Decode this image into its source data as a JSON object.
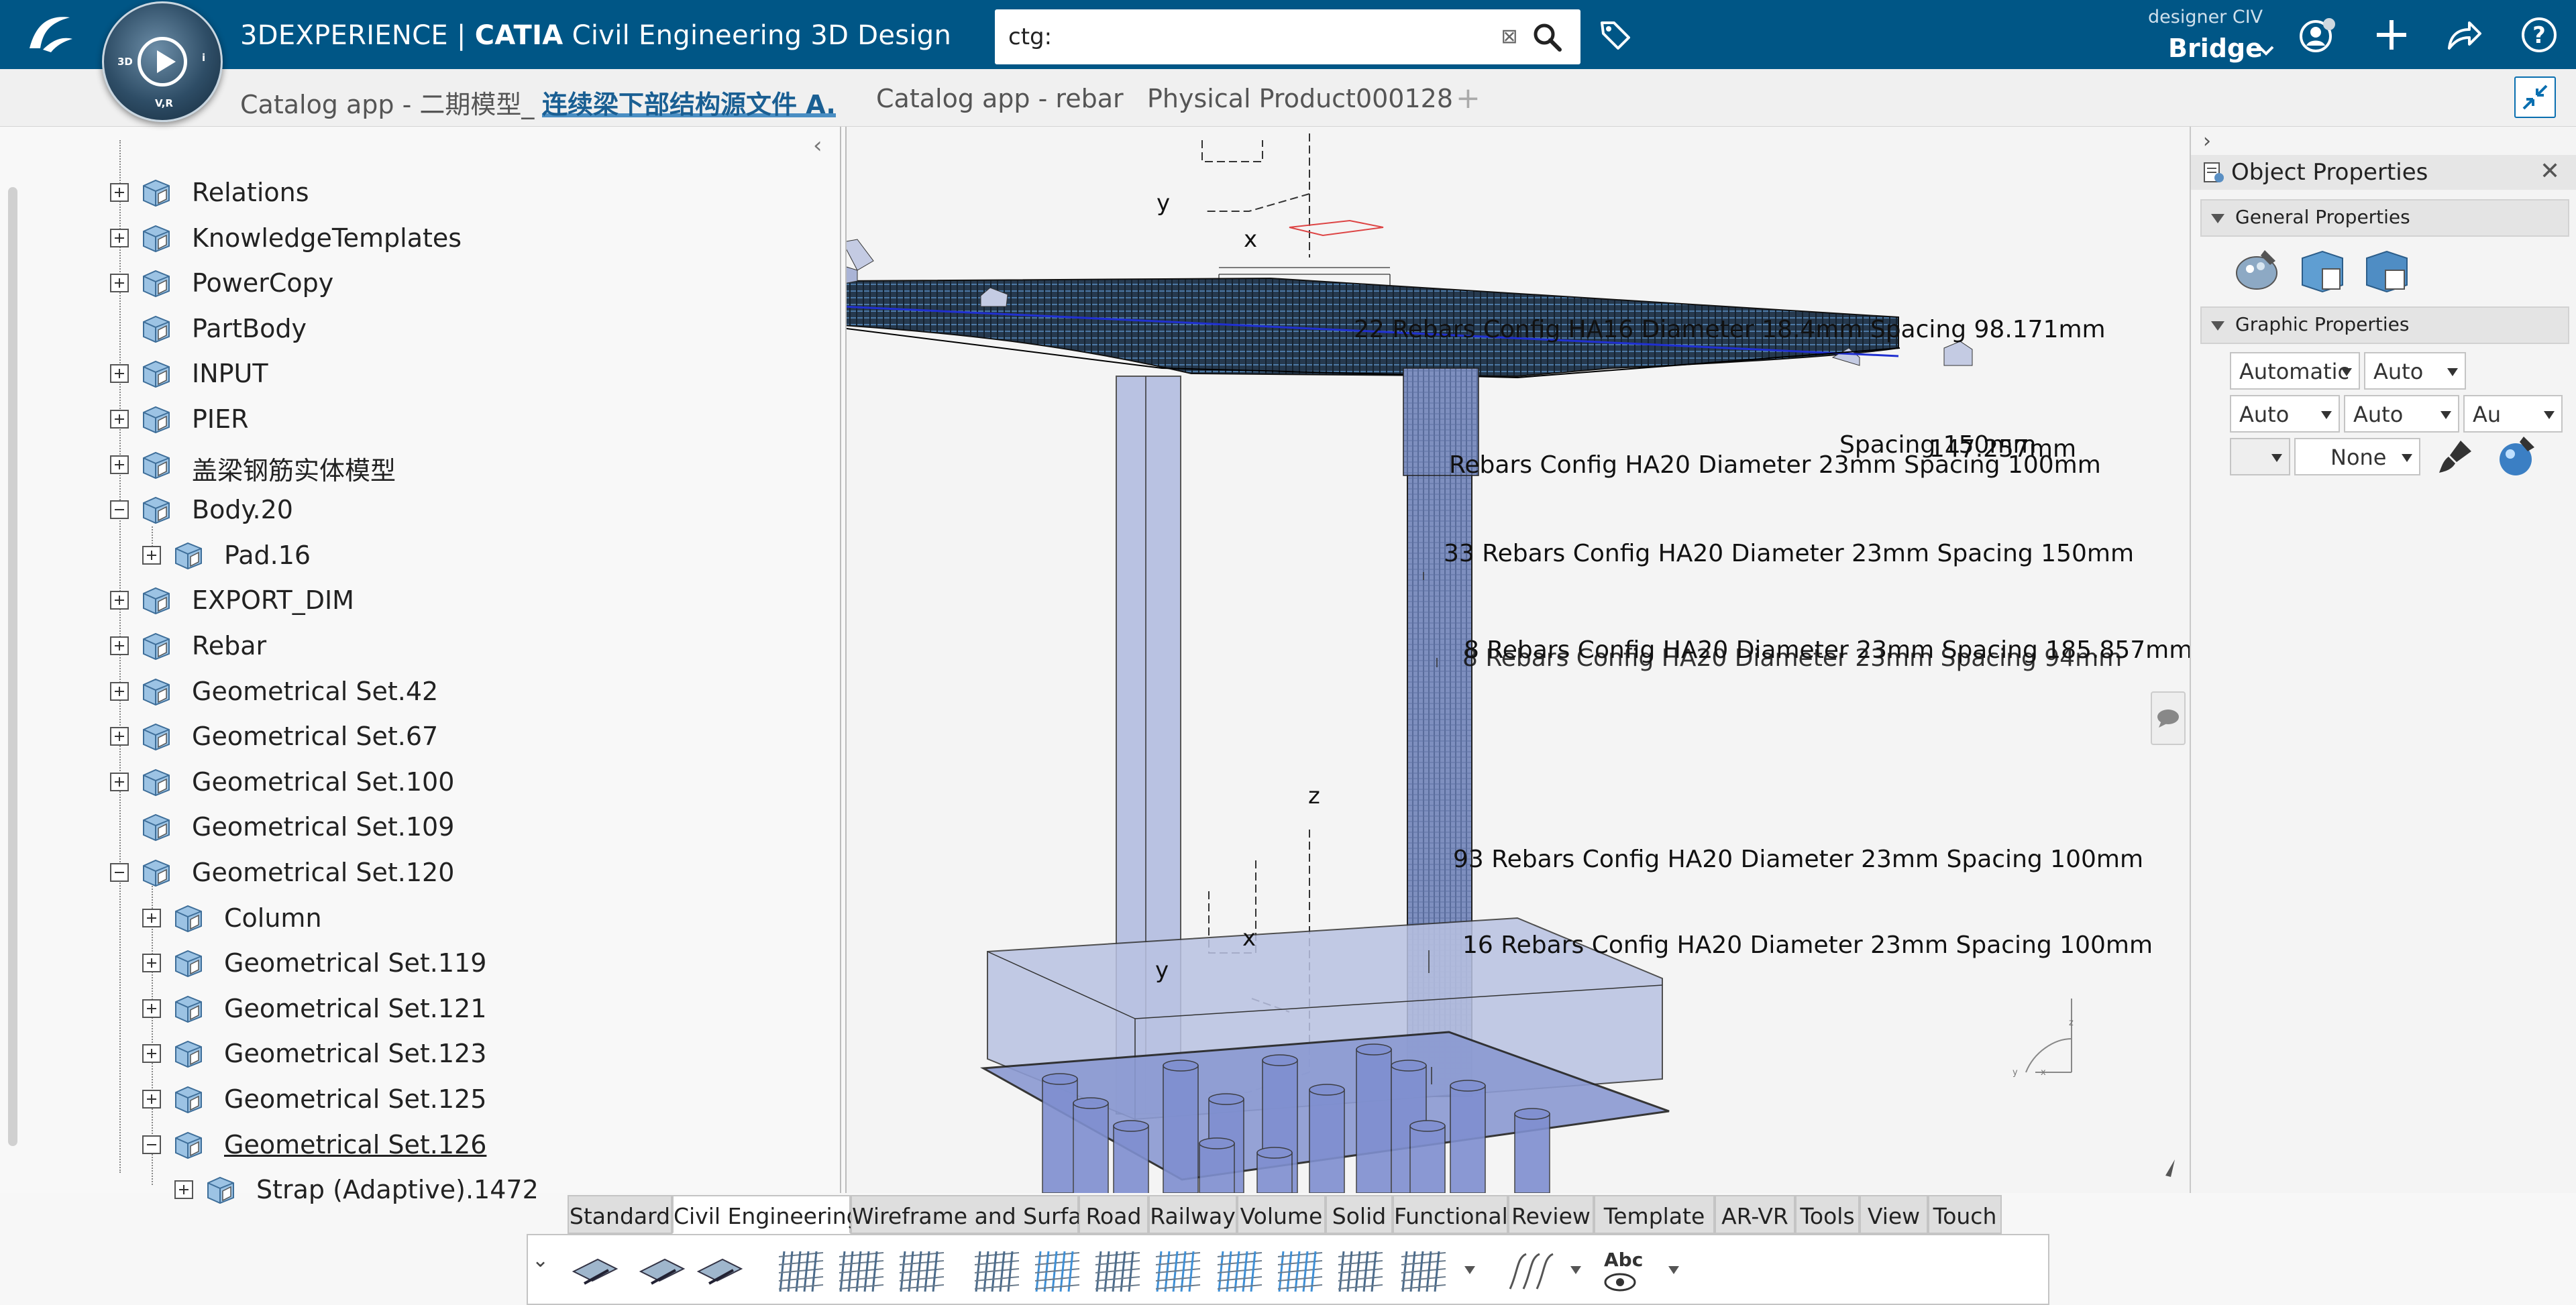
{
  "header": {
    "brand": "3DEXPERIENCE",
    "product": "CATIA",
    "app": "Civil Engineering 3D Design",
    "search_value": "ctg:",
    "user_role": "designer CIV",
    "user_space": "Bridge",
    "compass": {
      "q1": "3D",
      "q2": "V,R",
      "q3": "i"
    }
  },
  "tabs": [
    {
      "label": "Catalog app - 二期模型_",
      "active": false
    },
    {
      "label": "连续梁下部结构源文件 A.",
      "active": true
    },
    {
      "label": "Catalog app - rebar",
      "active": false
    },
    {
      "label": "Physical Product000128",
      "active": false
    }
  ],
  "tree": {
    "items": [
      {
        "label": "Relations",
        "level": 0,
        "state": "plus",
        "icon": "relations-icon"
      },
      {
        "label": "KnowledgeTemplates",
        "level": 0,
        "state": "plus",
        "icon": "knowledge-templates-icon"
      },
      {
        "label": "PowerCopy",
        "level": 0,
        "state": "plus",
        "icon": "power-copy-icon"
      },
      {
        "label": "PartBody",
        "level": 0,
        "state": "none",
        "icon": "part-body-icon"
      },
      {
        "label": "INPUT",
        "level": 0,
        "state": "plus",
        "icon": "geometrical-set-icon"
      },
      {
        "label": "PIER",
        "level": 0,
        "state": "plus",
        "icon": "geometrical-set-icon"
      },
      {
        "label": "盖梁钢筋实体模型",
        "level": 0,
        "state": "plus",
        "icon": "body-icon"
      },
      {
        "label": "Body.20",
        "level": 0,
        "state": "minus",
        "icon": "body-icon"
      },
      {
        "label": "Pad.16",
        "level": 1,
        "state": "plus",
        "icon": "pad-icon"
      },
      {
        "label": "EXPORT_DIM",
        "level": 0,
        "state": "plus",
        "icon": "export-dim-icon"
      },
      {
        "label": "Rebar",
        "level": 0,
        "state": "plus",
        "icon": "geometrical-set-icon"
      },
      {
        "label": "Geometrical Set.42",
        "level": 0,
        "state": "plus",
        "icon": "geometrical-set-icon"
      },
      {
        "label": "Geometrical Set.67",
        "level": 0,
        "state": "plus",
        "icon": "geometrical-set-icon"
      },
      {
        "label": "Geometrical Set.100",
        "level": 0,
        "state": "plus",
        "icon": "geometrical-set-icon"
      },
      {
        "label": "Geometrical Set.109",
        "level": 0,
        "state": "none",
        "icon": "geometrical-set-icon"
      },
      {
        "label": "Geometrical Set.120",
        "level": 0,
        "state": "minus",
        "icon": "geometrical-set-icon"
      },
      {
        "label": "Column",
        "level": 1,
        "state": "plus",
        "icon": "geometrical-set-icon"
      },
      {
        "label": "Geometrical Set.119",
        "level": 1,
        "state": "plus",
        "icon": "geometrical-set-icon"
      },
      {
        "label": "Geometrical Set.121",
        "level": 1,
        "state": "plus",
        "icon": "geometrical-set-icon"
      },
      {
        "label": "Geometrical Set.123",
        "level": 1,
        "state": "plus",
        "icon": "geometrical-set-icon"
      },
      {
        "label": "Geometrical Set.125",
        "level": 1,
        "state": "plus",
        "icon": "geometrical-set-icon"
      },
      {
        "label": "Geometrical Set.126",
        "level": 1,
        "state": "minus",
        "icon": "geometrical-set-icon",
        "underline": true
      },
      {
        "label": "Strap (Adaptive).1472",
        "level": 2,
        "state": "plus",
        "icon": "strap-icon"
      }
    ]
  },
  "viewport": {
    "axis_top_y": "y",
    "axis_top_x": "x",
    "axis_mid_z": "z",
    "axis_mid_x": "x",
    "axis_mid_y": "y",
    "annotations": [
      "22 Rebars Config HA16 Diameter 18.4mm Spacing 98.171mm",
      "Spacing 150mm",
      "147.257mm",
      "Rebars Config HA20 Diameter 23mm Spacing 100mm",
      "33 Rebars Config HA20 Diameter 23mm Spacing 150mm",
      "8 Rebars Config HA20 Diameter 23mm Spacing 185.857mm",
      "8 Rebars Config HA20 Diameter 23mm Spacing 94mm",
      "93 Rebars Config HA20 Diameter 23mm Spacing 100mm",
      "16 Rebars Config HA20 Diameter 23mm Spacing 100mm"
    ]
  },
  "properties": {
    "title": "Object Properties",
    "general_section": "General Properties",
    "graphic_section": "Graphic Properties",
    "combo_1": "Automatic",
    "combo_2": "Auto",
    "combo_3": "Auto",
    "combo_4": "Auto",
    "combo_5": "Au",
    "combo_6": "",
    "combo_7": "None"
  },
  "toolbar": {
    "tabs": [
      {
        "label": "Standard",
        "active": false
      },
      {
        "label": "Civil Engineering",
        "active": true
      },
      {
        "label": "Wireframe and Surface",
        "active": false
      },
      {
        "label": "Road",
        "active": false
      },
      {
        "label": "Railway",
        "active": false
      },
      {
        "label": "Volume",
        "active": false
      },
      {
        "label": "Solid",
        "active": false
      },
      {
        "label": "Functional",
        "active": false
      },
      {
        "label": "Review",
        "active": false
      },
      {
        "label": "Template",
        "active": false
      },
      {
        "label": "AR-VR",
        "active": false
      },
      {
        "label": "Tools",
        "active": false
      },
      {
        "label": "View",
        "active": false
      },
      {
        "label": "Touch",
        "active": false
      }
    ],
    "icons": [
      "bridge-deck-icon",
      "annotate-icon",
      "annotate-2-icon",
      "rebar-shape-icon",
      "reinforcement-icon",
      "rebar-set-icon",
      "rebar-grid-icon",
      "rebar-grid-blue-icon",
      "rebar-grid-2-icon",
      "rebar-layout-icon",
      "rebar-pattern-icon",
      "cage-icon",
      "schedule-icon",
      "rebar-display-icon",
      "curve-icon",
      "text-annotation-icon"
    ]
  },
  "colors": {
    "topbar": "#005686",
    "accent": "#4a8ec3",
    "model": "#8f9fcf"
  }
}
